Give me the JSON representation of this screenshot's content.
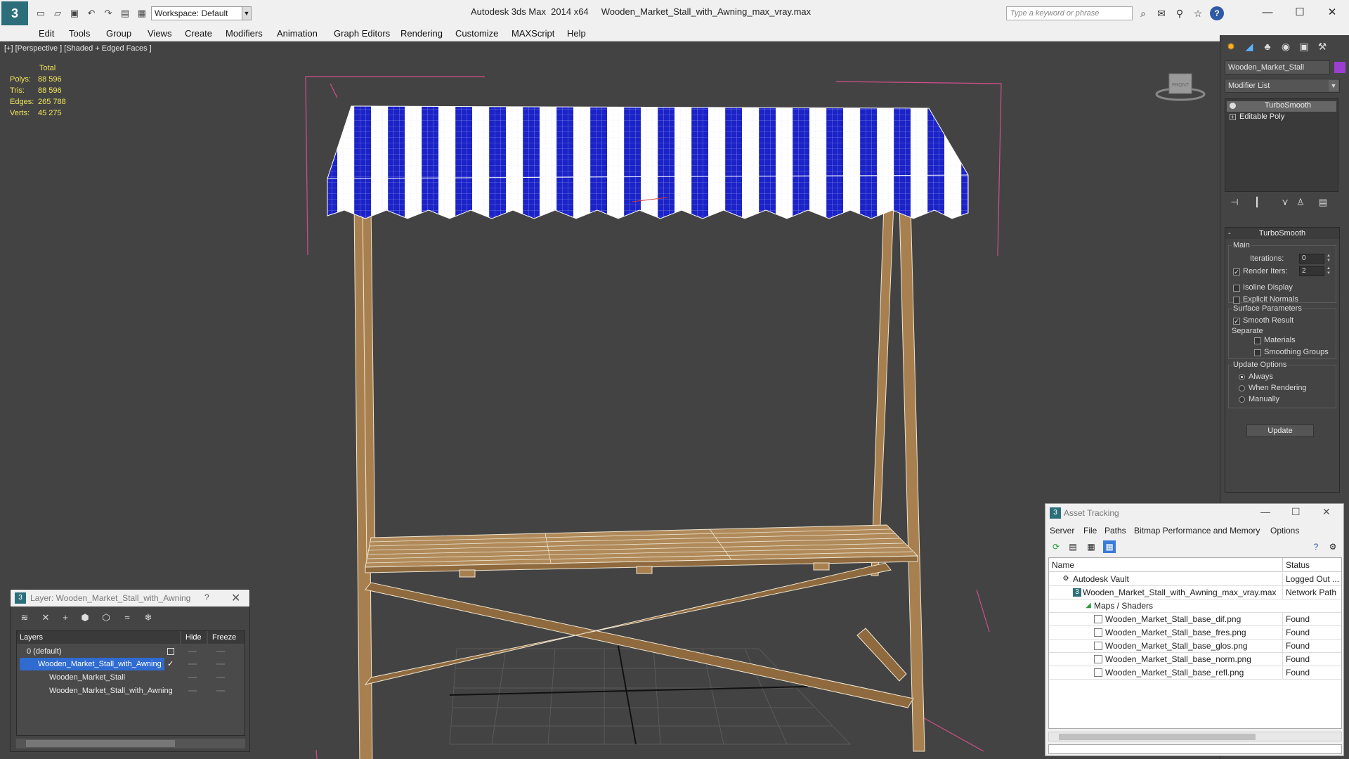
{
  "window": {
    "app_title": "Autodesk 3ds Max  2014 x64",
    "file_title": "Wooden_Market_Stall_with_Awning_max_vray.max",
    "workspace_label": "Workspace: Default",
    "search_placeholder": "Type a keyword or phrase"
  },
  "menu": [
    "Edit",
    "Tools",
    "Group",
    "Views",
    "Create",
    "Modifiers",
    "Animation",
    "Graph Editors",
    "Rendering",
    "Customize",
    "MAXScript",
    "Help"
  ],
  "viewport": {
    "label": "[+] [Perspective ] [Shaded + Edged Faces ]",
    "stats": {
      "total_label": "Total",
      "rows": [
        {
          "label": "Polys:",
          "value": "88 596"
        },
        {
          "label": "Tris:",
          "value": "88 596"
        },
        {
          "label": "Edges:",
          "value": "265 788"
        },
        {
          "label": "Verts:",
          "value": "45 275"
        }
      ]
    },
    "viewcube_label": "FRONT"
  },
  "command_panel": {
    "object_name": "Wooden_Market_Stall",
    "object_color": "#9b3fd1",
    "modifier_list_label": "Modifier List",
    "stack": [
      "TurboSmooth",
      "Editable Poly"
    ],
    "rollout_title": "TurboSmooth",
    "main_group": "Main",
    "iterations_label": "Iterations:",
    "iterations_value": "0",
    "render_iters_label": "Render Iters:",
    "render_iters_value": "2",
    "isoline_label": "Isoline Display",
    "explicit_normals_label": "Explicit Normals",
    "surface_group": "Surface Parameters",
    "smooth_result_label": "Smooth Result",
    "separate_label": "Separate",
    "materials_label": "Materials",
    "smoothing_groups_label": "Smoothing Groups",
    "update_group": "Update Options",
    "always_label": "Always",
    "when_rendering_label": "When Rendering",
    "manually_label": "Manually",
    "update_button": "Update"
  },
  "layer_window": {
    "title": "Layer: Wooden_Market_Stall_with_Awning",
    "help": "?",
    "headers": {
      "layers": "Layers",
      "hide": "Hide",
      "freeze": "Freeze"
    },
    "rows": [
      {
        "name": "0 (default)"
      },
      {
        "name": "Wooden_Market_Stall_with_Awning"
      },
      {
        "name": "Wooden_Market_Stall"
      },
      {
        "name": "Wooden_Market_Stall_with_Awning"
      }
    ]
  },
  "asset_window": {
    "title": "Asset Tracking",
    "menu": [
      "Server",
      "File",
      "Paths",
      "Bitmap Performance and Memory",
      "Options"
    ],
    "headers": {
      "name": "Name",
      "status": "Status"
    },
    "rows": [
      {
        "name": "Autodesk Vault",
        "status": "Logged Out ..."
      },
      {
        "name": "Wooden_Market_Stall_with_Awning_max_vray.max",
        "status": "Network Path"
      },
      {
        "name": "Maps / Shaders",
        "status": ""
      },
      {
        "name": "Wooden_Market_Stall_base_dif.png",
        "status": "Found"
      },
      {
        "name": "Wooden_Market_Stall_base_fres.png",
        "status": "Found"
      },
      {
        "name": "Wooden_Market_Stall_base_glos.png",
        "status": "Found"
      },
      {
        "name": "Wooden_Market_Stall_base_norm.png",
        "status": "Found"
      },
      {
        "name": "Wooden_Market_Stall_base_refl.png",
        "status": "Found"
      }
    ]
  },
  "colors": {
    "awning_blue": "#1a22c8",
    "wood": "#a88050",
    "selection_bracket": "#d0508a",
    "stats_yellow": "#f2e85a"
  }
}
